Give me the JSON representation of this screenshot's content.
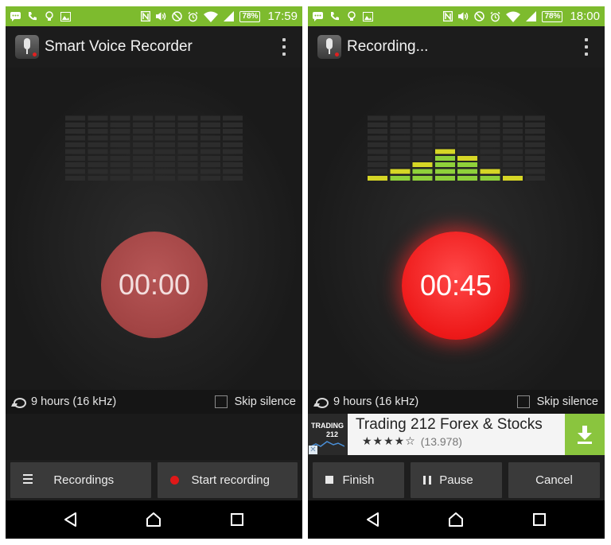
{
  "screens": [
    {
      "status": {
        "battery": "78%",
        "time": "17:59"
      },
      "appbar": {
        "title": "Smart Voice Recorder"
      },
      "timer": "00:00",
      "meter_levels": [
        0,
        0,
        0,
        0,
        0,
        0,
        0,
        0
      ],
      "info": {
        "quality": "9 hours (16 kHz)",
        "skip_silence": "Skip silence"
      },
      "buttons": {
        "recordings": "Recordings",
        "start": "Start recording"
      }
    },
    {
      "status": {
        "battery": "78%",
        "time": "18:00"
      },
      "appbar": {
        "title": "Recording..."
      },
      "timer": "00:45",
      "meter_levels": [
        1,
        2,
        3,
        5,
        4,
        2,
        1,
        0
      ],
      "info": {
        "quality": "9 hours (16 kHz)",
        "skip_silence": "Skip silence"
      },
      "ad": {
        "logo_line1": "TRADING",
        "logo_line2": "212",
        "title": "Trading 212 Forex & Stocks",
        "stars": "★★★★☆",
        "reviews": "(13.978)"
      },
      "buttons": {
        "finish": "Finish",
        "pause": "Pause",
        "cancel": "Cancel"
      }
    }
  ],
  "meter": {
    "segments": 10,
    "bars": 8
  },
  "colors": {
    "status_bar": "#7dbb2e",
    "meter_off": "#2c2c2c",
    "meter_yellow": "#d6d626",
    "meter_green": "#8fd13a",
    "record_idle": "#a24444",
    "record_active": "#ee1a1a",
    "ad_download": "#8ac53e"
  },
  "icons": {
    "status_left": [
      "messages-icon",
      "phone-icon",
      "bulb-icon",
      "image-icon"
    ],
    "status_right": [
      "nfc-icon",
      "volume-icon",
      "blocked-icon",
      "alarm-icon",
      "wifi-icon",
      "signal-icon",
      "battery-icon"
    ],
    "nav": [
      "back-icon",
      "home-icon",
      "recents-icon"
    ]
  }
}
